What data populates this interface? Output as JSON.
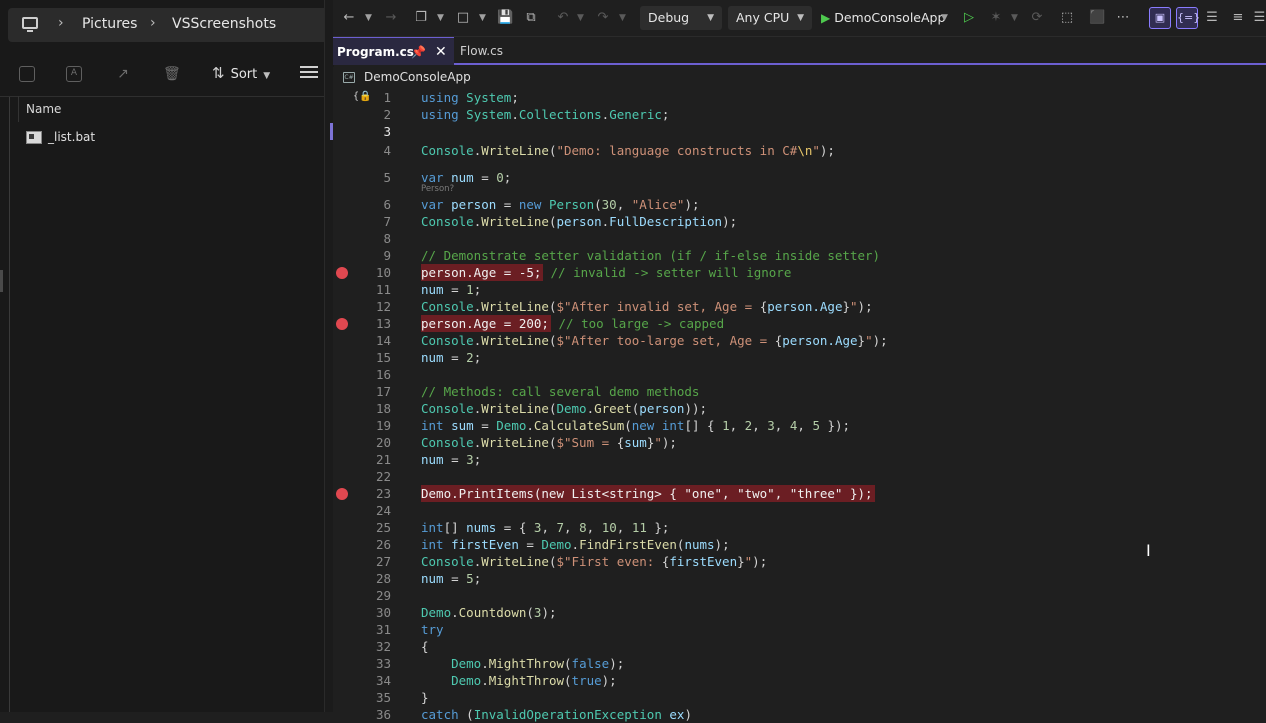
{
  "explorer": {
    "breadcrumb": [
      "Pictures",
      "VSScreenshots"
    ],
    "toolbar": {
      "icons": [
        "copy-icon",
        "rename-icon",
        "share-icon",
        "delete-icon"
      ],
      "sort_label": "Sort"
    },
    "column_header": "Name",
    "files": [
      {
        "name": "_list.bat",
        "icon": "bat-file-icon"
      }
    ]
  },
  "vs": {
    "toolbar": {
      "config": "Debug",
      "platform": "Any CPU",
      "startup_project": "DemoConsoleApp"
    },
    "tabs": [
      {
        "label": "Program.cs",
        "active": true
      },
      {
        "label": "Flow.cs",
        "active": false
      }
    ],
    "project": "DemoConsoleApp",
    "inline_hint": "Person?",
    "lines": [
      {
        "n": "1",
        "text": "using System;"
      },
      {
        "n": "2",
        "text": "using System.Collections.Generic;"
      },
      {
        "n": "3",
        "text": ""
      },
      {
        "n": "4",
        "text": "Console.WriteLine(\"Demo: language constructs in C#\\n\");"
      },
      {
        "n": "5",
        "text": "var num = 0;"
      },
      {
        "n": "6",
        "text": "var person = new Person(30, \"Alice\");"
      },
      {
        "n": "7",
        "text": "Console.WriteLine(person.FullDescription);"
      },
      {
        "n": "8",
        "text": ""
      },
      {
        "n": "9",
        "text": "// Demonstrate setter validation (if / if-else inside setter)"
      },
      {
        "n": "10",
        "text": "person.Age = -5;",
        "tail": " // invalid -> setter will ignore"
      },
      {
        "n": "11",
        "text": "num = 1;"
      },
      {
        "n": "12",
        "text": "Console.WriteLine($\"After invalid set, Age = {person.Age}\");"
      },
      {
        "n": "13",
        "text": "person.Age = 200;",
        "tail": " // too large -> capped"
      },
      {
        "n": "14",
        "text": "Console.WriteLine($\"After too-large set, Age = {person.Age}\");"
      },
      {
        "n": "15",
        "text": "num = 2;"
      },
      {
        "n": "16",
        "text": ""
      },
      {
        "n": "17",
        "text": "// Methods: call several demo methods"
      },
      {
        "n": "18",
        "text": "Console.WriteLine(Demo.Greet(person));"
      },
      {
        "n": "19",
        "text": "int sum = Demo.CalculateSum(new int[] { 1, 2, 3, 4, 5 });"
      },
      {
        "n": "20",
        "text": "Console.WriteLine($\"Sum = {sum}\");"
      },
      {
        "n": "21",
        "text": "num = 3;"
      },
      {
        "n": "22",
        "text": ""
      },
      {
        "n": "23",
        "text": "Demo.PrintItems(new List<string> { \"one\", \"two\", \"three\" });"
      },
      {
        "n": "24",
        "text": ""
      },
      {
        "n": "25",
        "text": "int[] nums = { 3, 7, 8, 10, 11 };"
      },
      {
        "n": "26",
        "text": "int firstEven = Demo.FindFirstEven(nums);"
      },
      {
        "n": "27",
        "text": "Console.WriteLine($\"First even: {firstEven}\");"
      },
      {
        "n": "28",
        "text": "num = 5;"
      },
      {
        "n": "29",
        "text": ""
      },
      {
        "n": "30",
        "text": "Demo.Countdown(3);"
      },
      {
        "n": "31",
        "text": "try"
      },
      {
        "n": "32",
        "text": "{"
      },
      {
        "n": "33",
        "text": "    Demo.MightThrow(false);"
      },
      {
        "n": "34",
        "text": "    Demo.MightThrow(true);"
      },
      {
        "n": "35",
        "text": "}"
      },
      {
        "n": "36",
        "text": "catch (InvalidOperationException ex)"
      }
    ],
    "breakpoint_lines": [
      "10",
      "13",
      "23"
    ],
    "current_line": "3",
    "colors": {
      "breakpoint": "#e04850",
      "breakpoint_highlight": "#6b1e23",
      "accent": "#6c5fd1",
      "keyword": "#569cd6",
      "type": "#4ec9b0",
      "string": "#ce9178",
      "method": "#dcdcaa",
      "variable": "#9cdcfe",
      "comment": "#57a64a",
      "number": "#b5cea8"
    }
  }
}
